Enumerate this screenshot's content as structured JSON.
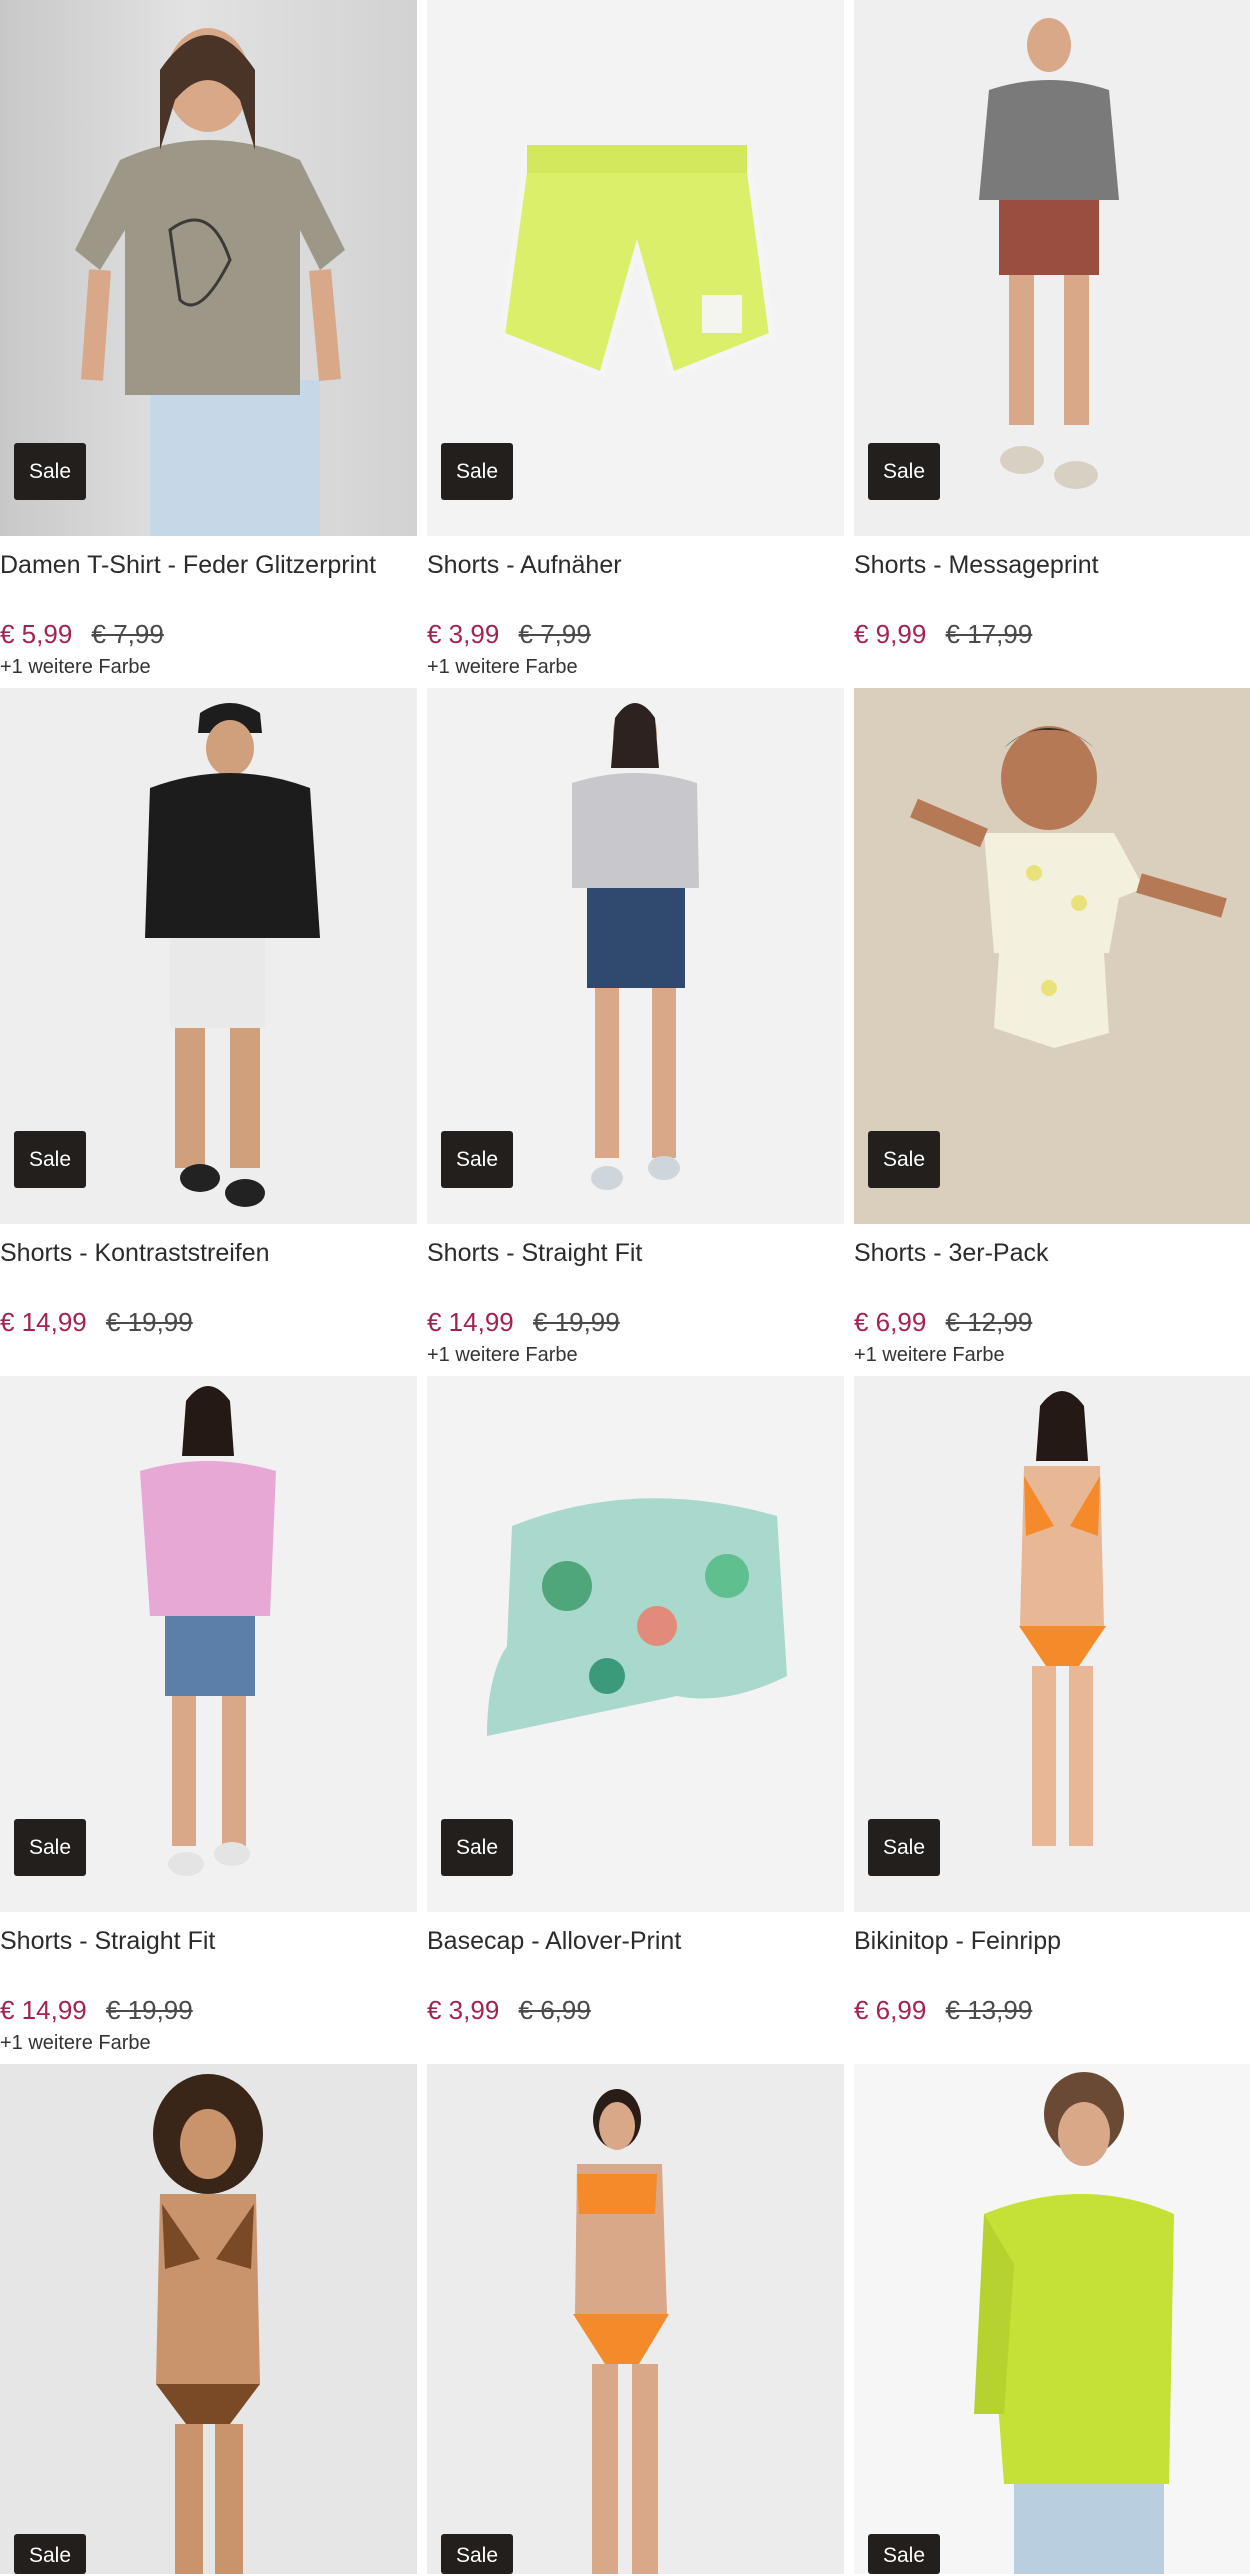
{
  "sale_label": "Sale",
  "products": [
    {
      "title": "Damen T-Shirt - Feder Glitzerprint",
      "price": "€ 5,99",
      "old_price": "€ 7,99",
      "colors": "+1 weitere Farbe"
    },
    {
      "title": "Shorts - Aufnäher",
      "price": "€ 3,99",
      "old_price": "€ 7,99",
      "colors": "+1 weitere Farbe"
    },
    {
      "title": "Shorts - Messageprint",
      "price": "€ 9,99",
      "old_price": "€ 17,99",
      "colors": ""
    },
    {
      "title": "Shorts - Kontraststreifen",
      "price": "€ 14,99",
      "old_price": "€ 19,99",
      "colors": ""
    },
    {
      "title": "Shorts - Straight Fit",
      "price": "€ 14,99",
      "old_price": "€ 19,99",
      "colors": "+1 weitere Farbe"
    },
    {
      "title": "Shorts - 3er-Pack",
      "price": "€ 6,99",
      "old_price": "€ 12,99",
      "colors": "+1 weitere Farbe"
    },
    {
      "title": "Shorts - Straight Fit",
      "price": "€ 14,99",
      "old_price": "€ 19,99",
      "colors": "+1 weitere Farbe"
    },
    {
      "title": "Basecap - Allover-Print",
      "price": "€ 3,99",
      "old_price": "€ 6,99",
      "colors": ""
    },
    {
      "title": "Bikinitop - Feinripp",
      "price": "€ 6,99",
      "old_price": "€ 13,99",
      "colors": ""
    }
  ],
  "colors": {
    "price": "#a3234f",
    "sale_badge": "#231f1c"
  }
}
